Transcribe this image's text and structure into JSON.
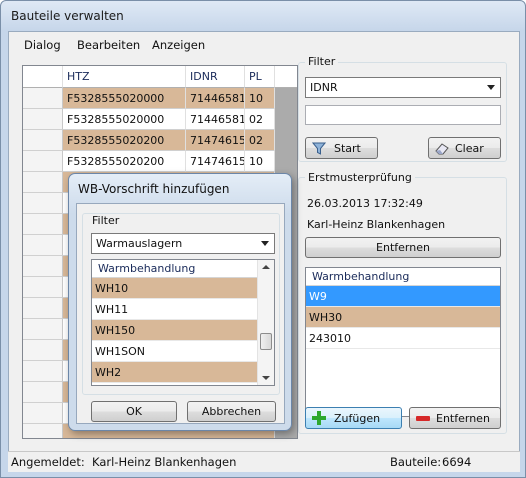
{
  "window": {
    "title": "Bauteile verwalten"
  },
  "menu": {
    "items": [
      "Dialog",
      "Bearbeiten",
      "Anzeigen"
    ]
  },
  "grid": {
    "columns": [
      "HTZ",
      "IDNR",
      "PL"
    ],
    "rows": [
      {
        "htz": "F5328555020000",
        "idnr": "71446581",
        "pl": "10",
        "tan": true
      },
      {
        "htz": "F5328555020000",
        "idnr": "71446581",
        "pl": "02",
        "tan": false
      },
      {
        "htz": "F5328555020200",
        "idnr": "71474615",
        "pl": "02",
        "tan": true
      },
      {
        "htz": "F5328555020200",
        "idnr": "71474615",
        "pl": "10",
        "tan": false
      }
    ]
  },
  "filter": {
    "group_label": "Filter",
    "selected": "IDNR",
    "text_value": "",
    "start_label": "Start",
    "clear_label": "Clear"
  },
  "erstmuster": {
    "group_label": "Erstmusterprüfung",
    "datetime": "26.03.2013 17:32:49",
    "user": "Karl-Heinz Blankenhagen",
    "remove_label": "Entfernen",
    "list_header": "Warmbehandlung",
    "items": [
      {
        "label": "W9",
        "state": "selected"
      },
      {
        "label": "WH30",
        "state": "tan"
      },
      {
        "label": "243010",
        "state": "plain"
      }
    ],
    "add_label": "Zufügen",
    "remove2_label": "Entfernen"
  },
  "dialog": {
    "title": "WB-Vorschrift hinzufügen",
    "filter_label": "Filter",
    "combo_value": "Warmauslagern",
    "list_header": "Warmbehandlung",
    "items": [
      {
        "label": "WH10",
        "tan": true
      },
      {
        "label": "WH11",
        "tan": false
      },
      {
        "label": "WH150",
        "tan": true
      },
      {
        "label": "WH1SON",
        "tan": false
      },
      {
        "label": "WH2",
        "tan": true
      }
    ],
    "ok_label": "OK",
    "cancel_label": "Abbrechen"
  },
  "status": {
    "logged_label": "Angemeldet:",
    "logged_user": "Karl-Heinz Blankenhagen",
    "parts_label": "Bauteile:",
    "parts_count": "6694"
  },
  "colors": {
    "row_tan": "#d8b898",
    "selection": "#3399ff",
    "add_icon": "#2ea82e",
    "remove_icon": "#d62828"
  }
}
